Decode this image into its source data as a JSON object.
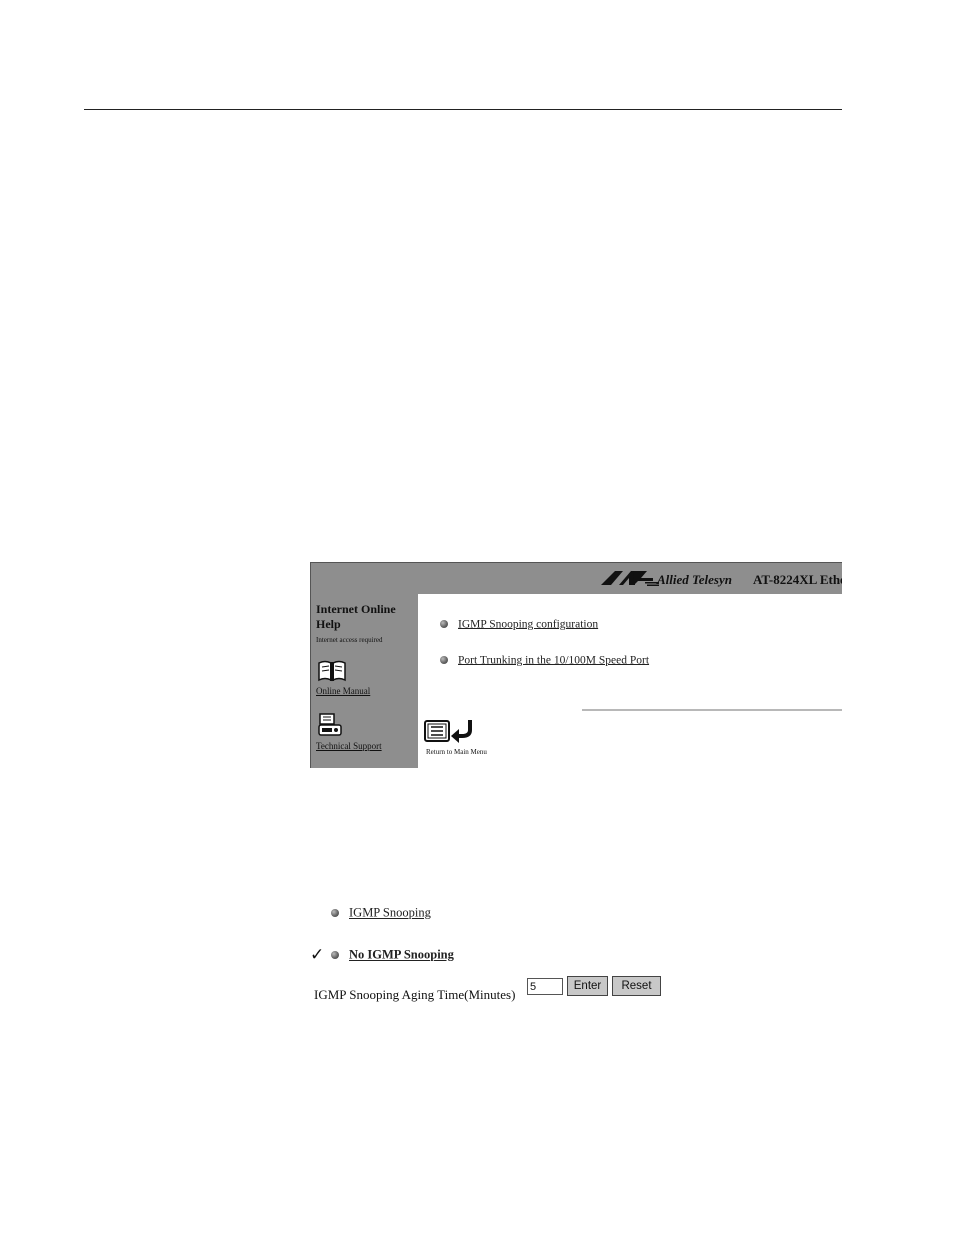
{
  "header": {
    "brand": "Allied Telesyn",
    "model": "AT-8224XL Ethe"
  },
  "sidebar": {
    "help_title": "Internet Online Help",
    "help_note": "Internet access required",
    "online_manual": "Online Manual",
    "technical_support": "Technical Support"
  },
  "menu": {
    "items": [
      {
        "label": "IGMP Snooping configuration"
      },
      {
        "label": "Port Trunking in the 10/100M Speed Port"
      }
    ],
    "return_label": "Return to Main Menu"
  },
  "igmp": {
    "options": [
      {
        "label": "IGMP Snooping",
        "selected": false
      },
      {
        "label": "No IGMP Snooping",
        "selected": true
      }
    ],
    "aging_label": "IGMP Snooping Aging Time(Minutes)",
    "aging_value": "5",
    "enter_label": "Enter",
    "reset_label": "Reset"
  },
  "icons": [
    "allied-telesyn-logo-icon",
    "book-icon",
    "telephone-icon",
    "menu-list-icon",
    "return-arrow-icon",
    "checkmark-icon",
    "bullet-icon"
  ]
}
